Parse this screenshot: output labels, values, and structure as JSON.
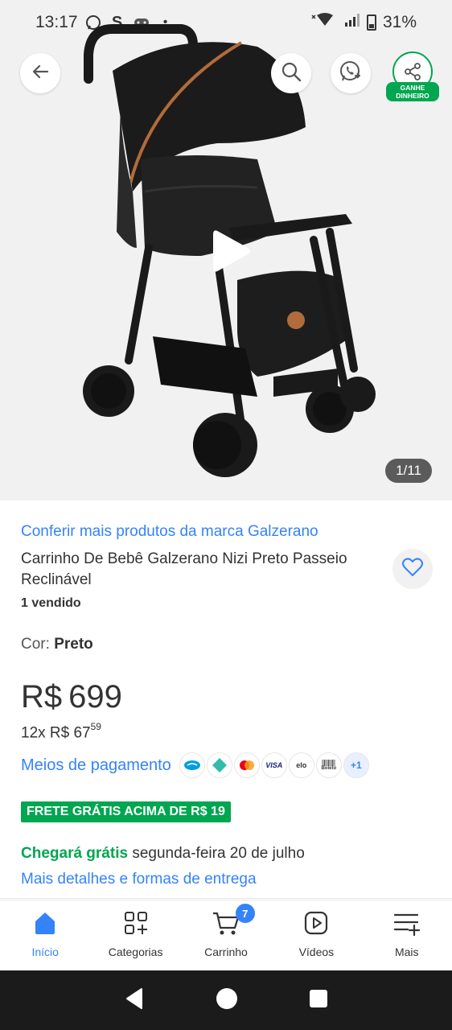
{
  "status_bar": {
    "time": "13:17",
    "battery": "31%",
    "notif_letter": "S"
  },
  "hero": {
    "image_counter": "1/11",
    "share_badge": "GANHE DINHEIRO"
  },
  "product": {
    "brand_link": "Conferir mais produtos da marca Galzerano",
    "title": "Carrinho De Bebê Galzerano Nizi Preto Passeio Reclinável",
    "sold": "1 vendido",
    "color_label": "Cor: ",
    "color_value": "Preto",
    "currency": "R$",
    "price": "699",
    "installments_prefix": "12x R$ 67",
    "installments_cents": "59",
    "payments_link": "Meios de pagamento",
    "payment_icons": [
      "mercadopago-icon",
      "pix-icon",
      "mastercard-icon",
      "visa-icon",
      "elo-icon",
      "boleto-icon"
    ],
    "payment_labels": {
      "visa": "VISA",
      "elo": "elo",
      "boleto": "Boleto",
      "more": "+1"
    },
    "free_shipping_badge": "FRETE GRÁTIS ACIMA DE R$ 19",
    "arrival_free": "Chegará grátis",
    "arrival_date": " segunda-feira 20 de julho",
    "delivery_link": "Mais detalhes e formas de entrega"
  },
  "bottom_nav": {
    "items": [
      {
        "label": "Início",
        "icon": "home-icon",
        "active": true
      },
      {
        "label": "Categorias",
        "icon": "grid-icon"
      },
      {
        "label": "Carrinho",
        "icon": "cart-icon",
        "badge": "7"
      },
      {
        "label": "Vídeos",
        "icon": "play-icon"
      },
      {
        "label": "Mais",
        "icon": "menu-icon"
      }
    ]
  },
  "colors": {
    "accent": "#3483fa",
    "green": "#00a650"
  }
}
